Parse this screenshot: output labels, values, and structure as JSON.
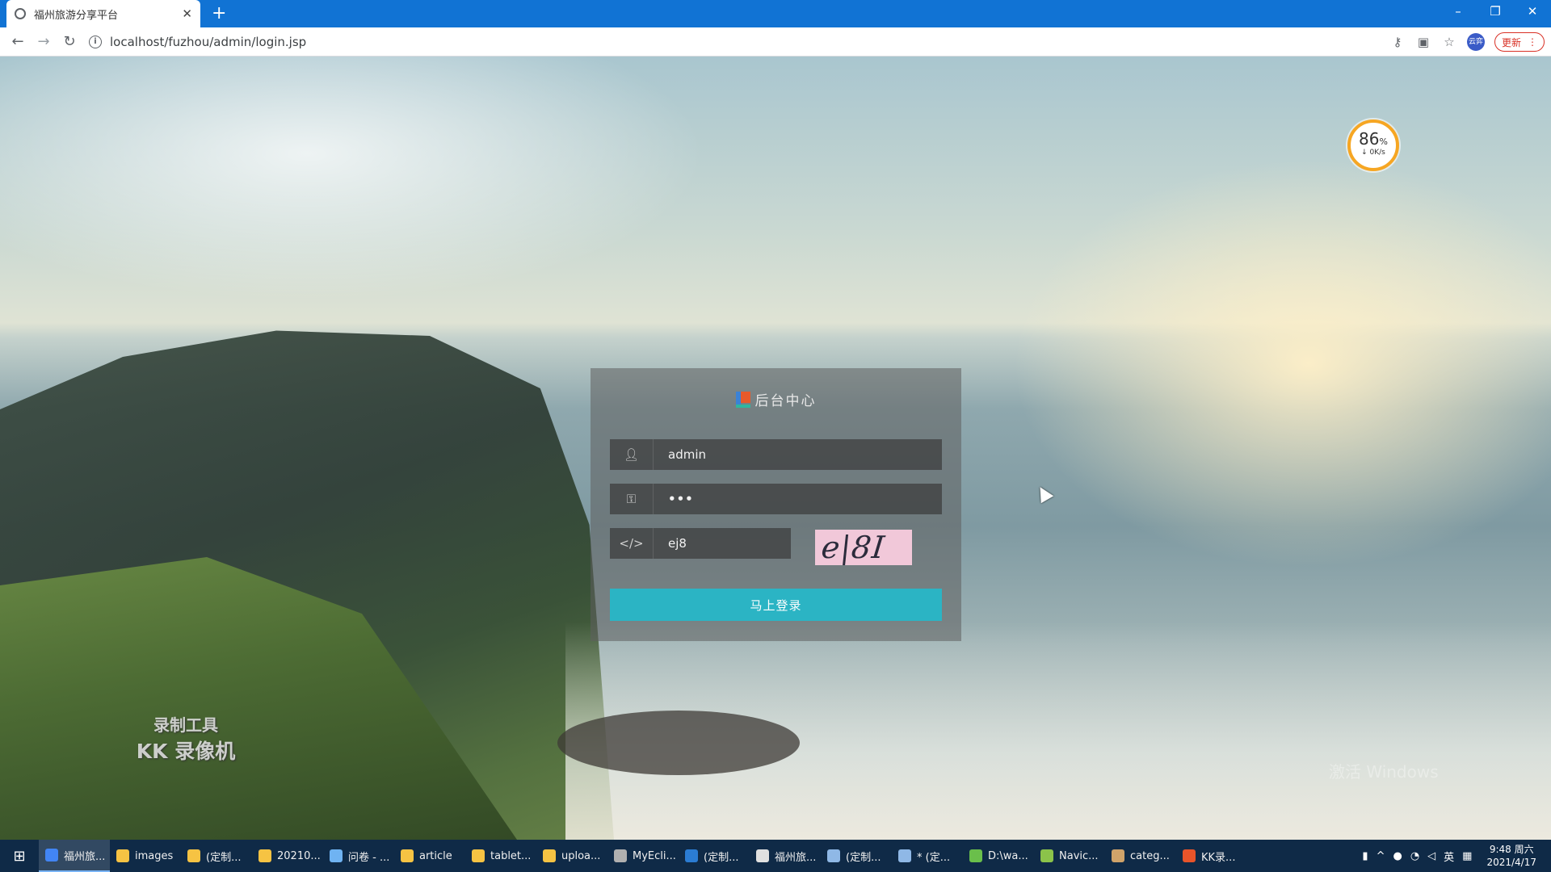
{
  "browser": {
    "tab_title": "福州旅游分享平台",
    "tab_close": "✕",
    "new_tab": "+",
    "url": "localhost/fuzhou/admin/login.jsp",
    "profile_badge": "云弈",
    "update_label": "更新",
    "window_controls": [
      "–",
      "❐",
      "✕"
    ]
  },
  "login": {
    "brand": "后台中心",
    "username_value": "admin",
    "password_value": "•••",
    "code_value": "ej8",
    "captcha_text": "e|8I",
    "submit_label": "马上登录"
  },
  "speed_widget": {
    "percent": "86",
    "percent_unit": "%",
    "rate": "↓ 0K/s"
  },
  "watermark": {
    "line1": "录制工具",
    "line2": "KK 录像机"
  },
  "activate_text": "激活 Windows",
  "taskbar": {
    "items": [
      {
        "label": "福州旅...",
        "color": "#4285f4"
      },
      {
        "label": "images",
        "color": "#f6c343"
      },
      {
        "label": "(定制...",
        "color": "#f6c343"
      },
      {
        "label": "20210...",
        "color": "#f6c343"
      },
      {
        "label": "问卷 - ...",
        "color": "#6fb3f2"
      },
      {
        "label": "article",
        "color": "#f6c343"
      },
      {
        "label": "tablet...",
        "color": "#f6c343"
      },
      {
        "label": "uploa...",
        "color": "#f6c343"
      },
      {
        "label": "MyEcli...",
        "color": "#b0b0b0"
      },
      {
        "label": "(定制...",
        "color": "#2b7cd3"
      },
      {
        "label": "福州旅...",
        "color": "#e0e0e0"
      },
      {
        "label": "(定制...",
        "color": "#8fb8e6"
      },
      {
        "label": "* (定...",
        "color": "#8fb8e6"
      },
      {
        "label": "D:\\wa...",
        "color": "#6abf4b"
      },
      {
        "label": "Navic...",
        "color": "#8bc34a"
      },
      {
        "label": "categ...",
        "color": "#cfa36a"
      },
      {
        "label": "KK录...",
        "color": "#e8542a"
      }
    ],
    "ime": "英",
    "time": "9:48 周六",
    "date": "2021/4/17"
  }
}
